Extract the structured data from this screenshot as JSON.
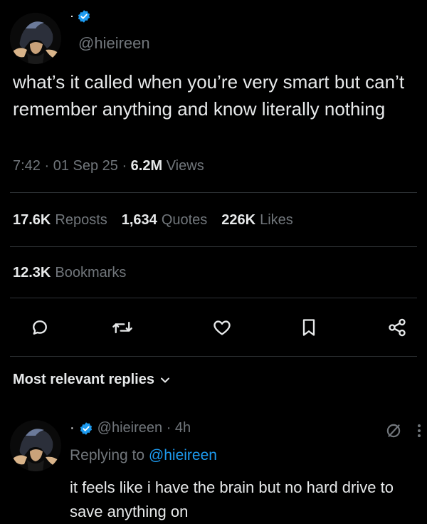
{
  "author": {
    "name": "·",
    "handle": "@hieireen",
    "verified": true
  },
  "tweet": {
    "text": "what’s it called when you’re very smart but can’t remember anything and know literally nothing",
    "time": "7:42 · 01 Sep 25 · ",
    "views_count": "6.2M",
    "views_label": "Views"
  },
  "stats": {
    "reposts_count": "17.6K",
    "reposts_label": "Reposts",
    "quotes_count": "1,634",
    "quotes_label": "Quotes",
    "likes_count": "226K",
    "likes_label": "Likes",
    "bookmarks_count": "12.3K",
    "bookmarks_label": "Bookmarks"
  },
  "actions": {
    "icons": [
      "reply-icon",
      "repost-icon",
      "like-icon",
      "bookmark-icon",
      "share-icon"
    ]
  },
  "replies": {
    "sort_label": "Most relevant replies"
  },
  "reply": {
    "name": "·",
    "handle_time": "@hieireen · 4h",
    "replying_prefix": "Replying to ",
    "replying_to": "@hieireen",
    "text": "it feels like i have the brain but no hard drive to save anything on"
  },
  "colors": {
    "background": "#000000",
    "text": "#e7e9ea",
    "muted": "#71767b",
    "accent": "#1d9bf0",
    "divider": "#2f3336"
  }
}
